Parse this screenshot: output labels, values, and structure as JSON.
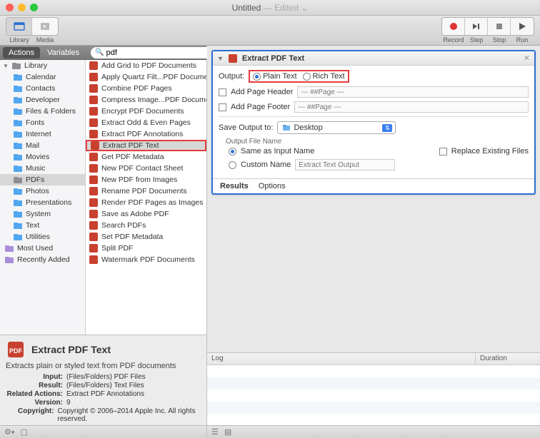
{
  "window": {
    "title": "Untitled",
    "subtitle": "— Edited",
    "chev": "⌄"
  },
  "toolbar": {
    "left": [
      "Library",
      "Media"
    ],
    "right": [
      "Record",
      "Step",
      "Stop",
      "Run"
    ]
  },
  "subheader": {
    "tabs": [
      "Actions",
      "Variables"
    ],
    "search_value": "pdf"
  },
  "sidebar": {
    "root": "Library",
    "items": [
      "Calendar",
      "Contacts",
      "Developer",
      "Files & Folders",
      "Fonts",
      "Internet",
      "Mail",
      "Movies",
      "Music",
      "PDFs",
      "Photos",
      "Presentations",
      "System",
      "Text",
      "Utilities"
    ],
    "selected": "PDFs",
    "extras": [
      "Most Used",
      "Recently Added"
    ]
  },
  "actions": {
    "items": [
      "Add Grid to PDF Documents",
      "Apply Quartz Filt...PDF Documents",
      "Combine PDF Pages",
      "Compress Image...PDF Documents",
      "Encrypt PDF Documents",
      "Extract Odd & Even Pages",
      "Extract PDF Annotations",
      "Extract PDF Text",
      "Get PDF Metadata",
      "New PDF Contact Sheet",
      "New PDF from Images",
      "Rename PDF Documents",
      "Render PDF Pages as Images",
      "Save as Adobe PDF",
      "Search PDFs",
      "Set PDF Metadata",
      "Split PDF",
      "Watermark PDF Documents"
    ],
    "selected": "Extract PDF Text"
  },
  "info": {
    "title": "Extract PDF Text",
    "desc": "Extracts plain or styled text from PDF documents",
    "rows": [
      {
        "k": "Input:",
        "v": "(Files/Folders) PDF Files"
      },
      {
        "k": "Result:",
        "v": "(Files/Folders) Text Files"
      },
      {
        "k": "Related Actions:",
        "v": "Extract PDF Annotations"
      },
      {
        "k": "Version:",
        "v": "9"
      },
      {
        "k": "Copyright:",
        "v": "Copyright © 2006–2014 Apple Inc. All rights reserved."
      }
    ]
  },
  "card": {
    "title": "Extract PDF Text",
    "output_label": "Output:",
    "radio1": "Plain Text",
    "radio2": "Rich Text",
    "chk1": "Add Page Header",
    "ph1": "--- ##Page ---",
    "chk2": "Add Page Footer",
    "ph2": "--- ##Page ---",
    "save_label": "Save Output to:",
    "save_dest": "Desktop",
    "ofn_label": "Output File Name",
    "same": "Same as Input Name",
    "custom": "Custom Name",
    "custom_ph": "Extract Text Output",
    "replace": "Replace Existing Files",
    "footer": [
      "Results",
      "Options"
    ]
  },
  "log": {
    "col1": "Log",
    "col2": "Duration"
  }
}
